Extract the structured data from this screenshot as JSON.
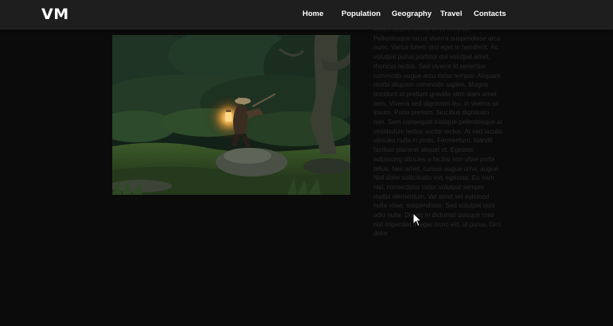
{
  "header": {
    "logo_text": "VM",
    "nav": {
      "home": "Home",
      "population": "Population",
      "geography": "Geography",
      "travel": "Travel",
      "contacts": "Contacts"
    }
  },
  "main": {
    "image": {
      "description_icon": "photo-icon"
    },
    "body_text": "facilisi aliquet lectus urna tempus. Pellentesque lacus viverra suspendisse arcu nunc. Varius lorem orci eget in hendrerit. Ac volutpat purus porttitor dui volutpat amet, rhoncus lectus. Sed viverra id senectus commodo augue arcu tortor tempor. Aliquam morbi aliquam commodo sapien. Magna tincidunt at pretium gravida nibh diam amet sem. Viverra sed dignissim leo, in viverra sit ipsum. Porta pretium, faucibus dignissim non. Sem consequat tristique pellentesque at vestibulum lectus auctor lectus. At sed iaculis ultricies nulla in proin. Fermentum, blandit facilisis placerat aliquet ut. Egestas adipiscing ultricies a facilisi non vitae porta tellus. Nec amet, cursus augue urna, augue. Nisl dolor sollicitudin est, egestas. Eu nam nisl, consectetur tortor volutpat semper mattis elementum. Vel amet vel euismod nulla vitae, suspendisse. Sed volutpat quis odio nulla. Donec in dictumst quisque cras nisl imperdiet integer nunc elit, ut purus. Orci dolor"
  },
  "colors": {
    "background": "#0b0b0b",
    "navbar": "#1e1e1e",
    "nav_text": "#ffffff",
    "body_text": "#2a2a2a"
  },
  "cursor": "arrow-cursor-icon"
}
